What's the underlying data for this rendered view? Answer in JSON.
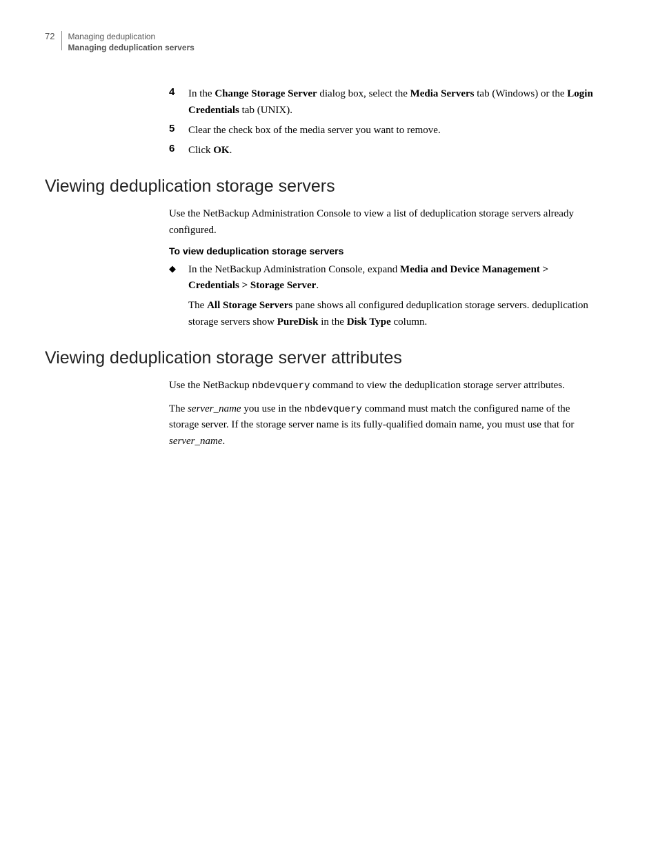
{
  "header": {
    "page_number": "72",
    "chapter": "Managing deduplication",
    "section": "Managing deduplication servers"
  },
  "steps": {
    "s4_num": "4",
    "s4_pre": "In the ",
    "s4_b1": "Change Storage Server",
    "s4_mid1": " dialog box, select the ",
    "s4_b2": "Media Servers",
    "s4_mid2": " tab (Windows) or the ",
    "s4_b3": "Login Credentials",
    "s4_post": " tab (UNIX).",
    "s5_num": "5",
    "s5_text": "Clear the check box of the media server you want to remove.",
    "s6_num": "6",
    "s6_pre": "Click ",
    "s6_b1": "OK",
    "s6_post": "."
  },
  "sec1": {
    "heading": "Viewing deduplication storage servers",
    "p1": "Use the NetBackup Administration Console to view a list of deduplication storage servers already configured.",
    "sub": "To view deduplication storage servers",
    "b1_pre": "In the NetBackup Administration Console, expand ",
    "b1_bold": "Media and Device Management > Credentials > Storage Server",
    "b1_post": ".",
    "b2_pre": "The ",
    "b2_b1": "All Storage Servers",
    "b2_mid1": " pane shows all configured deduplication storage servers. deduplication storage servers show ",
    "b2_b2": "PureDisk",
    "b2_mid2": " in the ",
    "b2_b3": "Disk Type",
    "b2_post": " column."
  },
  "sec2": {
    "heading": "Viewing deduplication storage server attributes",
    "p1_pre": "Use the NetBackup ",
    "p1_code": "nbdevquery",
    "p1_post": " command to view the deduplication storage server attributes.",
    "p2_pre": "The ",
    "p2_i1": "server_name",
    "p2_mid1": " you use in the ",
    "p2_code": "nbdevquery",
    "p2_mid2": " command must match the configured name of the storage server. If the storage server name is its fully-qualified domain name, you must use that for ",
    "p2_i2": "server_name",
    "p2_post": "."
  }
}
